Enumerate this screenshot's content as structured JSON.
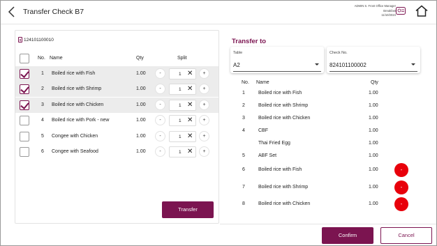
{
  "header": {
    "title": "Transfer Check B7",
    "user_line1": "ADMIN S. Front Office Manager",
    "user_line2": "Breakfast",
    "user_line3": "11/10/2024"
  },
  "left": {
    "check_number": "124101100010",
    "columns": {
      "no": "No.",
      "name": "Name",
      "qty": "Qty",
      "split": "Split"
    },
    "items": [
      {
        "no": "1",
        "name": "Boiled rice with Fish",
        "qty": "1.00",
        "split": "1",
        "checked": true
      },
      {
        "no": "2",
        "name": "Boiled rice with Shrimp",
        "qty": "1.00",
        "split": "1",
        "checked": true
      },
      {
        "no": "3",
        "name": "Boiled rice with Chicken",
        "qty": "1.00",
        "split": "1",
        "checked": true
      },
      {
        "no": "4",
        "name": "Boiled rice with Pork - new",
        "qty": "1.00",
        "split": "1",
        "checked": false
      },
      {
        "no": "5",
        "name": "Congee with Chicken",
        "qty": "1.00",
        "split": "1",
        "checked": false
      },
      {
        "no": "6",
        "name": "Congee with Seafood",
        "qty": "1.00",
        "split": "1",
        "checked": false
      }
    ],
    "minus_label": "-",
    "plus_label": "+",
    "clear_glyph": "✕",
    "transfer_label": "Transfer"
  },
  "right": {
    "heading": "Transfer to",
    "table_label": "Table",
    "table_value": "A2",
    "check_label": "Check No.",
    "check_value": "824101100002",
    "columns": {
      "no": "No.",
      "name": "Name",
      "qty": "Qty"
    },
    "items": [
      {
        "no": "1",
        "name": "Boiled rice with Fish",
        "qty": "1.00",
        "removable": false
      },
      {
        "no": "2",
        "name": "Boiled rice with Shrimp",
        "qty": "1.00",
        "removable": false
      },
      {
        "no": "3",
        "name": "Boiled rice with Chicken",
        "qty": "1.00",
        "removable": false
      },
      {
        "no": "4",
        "name": "CBF",
        "qty": "1.00",
        "removable": false
      },
      {
        "no": "",
        "name": "Thai Fried Egg",
        "qty": "1.00",
        "removable": false
      },
      {
        "no": "5",
        "name": "ABF Set",
        "qty": "1.00",
        "removable": false
      },
      {
        "no": "6",
        "name": "Boiled rice with Fish",
        "qty": "1.00",
        "removable": true
      },
      {
        "no": "7",
        "name": "Boiled rice with Shrimp",
        "qty": "1.00",
        "removable": true
      },
      {
        "no": "8",
        "name": "Boiled rice with Chicken",
        "qty": "1.00",
        "removable": true
      }
    ],
    "remove_label": "-"
  },
  "footer": {
    "confirm_label": "Confirm",
    "cancel_label": "Cancel"
  },
  "colors": {
    "accent": "#7b1450",
    "danger": "#e8000b",
    "selected_row": "#ececec"
  },
  "icons": [
    "back-arrow-icon",
    "user-card-icon",
    "home-icon",
    "receipt-icon",
    "checkbox-icon",
    "clear-icon"
  ]
}
